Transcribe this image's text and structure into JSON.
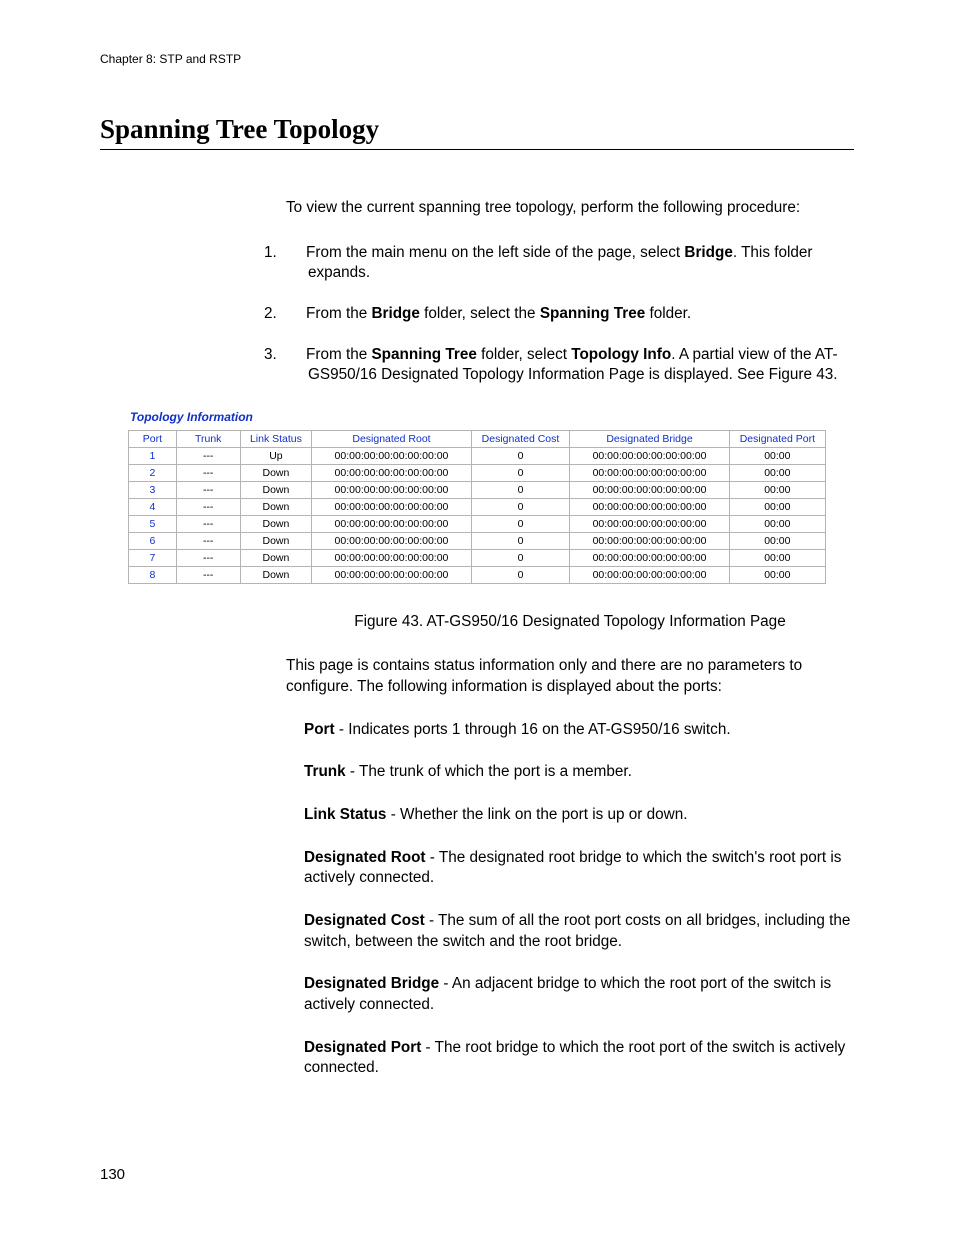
{
  "header": {
    "chapter": "Chapter 8: STP and RSTP"
  },
  "section_title": "Spanning Tree Topology",
  "intro": "To view the current spanning tree topology, perform the following procedure:",
  "steps": {
    "one": {
      "num": "1.",
      "pre": "From the main menu on the left side of the page, select ",
      "bold": "Bridge",
      "post": ". This folder expands."
    },
    "two": {
      "num": "2.",
      "pre": "From the ",
      "b1": "Bridge",
      "mid": " folder, select the ",
      "b2": "Spanning Tree",
      "post": " folder."
    },
    "three": {
      "num": "3.",
      "pre": "From the ",
      "b1": "Spanning Tree",
      "mid": " folder, select ",
      "b2": "Topology Info",
      "post": ". A partial view of the AT-GS950/16 Designated Topology Information Page is displayed. See Figure 43."
    }
  },
  "figure": {
    "title": "Topology Information",
    "headers": {
      "port": "Port",
      "trunk": "Trunk",
      "link": "Link Status",
      "root": "Designated Root",
      "cost": "Designated Cost",
      "bridge": "Designated Bridge",
      "dport": "Designated Port"
    },
    "rows": {
      "r1": {
        "port": "1",
        "trunk": "---",
        "link": "Up",
        "root": "00:00:00:00:00:00:00:00",
        "cost": "0",
        "bridge": "00:00:00:00:00:00:00:00",
        "dport": "00:00"
      },
      "r2": {
        "port": "2",
        "trunk": "---",
        "link": "Down",
        "root": "00:00:00:00:00:00:00:00",
        "cost": "0",
        "bridge": "00:00:00:00:00:00:00:00",
        "dport": "00:00"
      },
      "r3": {
        "port": "3",
        "trunk": "---",
        "link": "Down",
        "root": "00:00:00:00:00:00:00:00",
        "cost": "0",
        "bridge": "00:00:00:00:00:00:00:00",
        "dport": "00:00"
      },
      "r4": {
        "port": "4",
        "trunk": "---",
        "link": "Down",
        "root": "00:00:00:00:00:00:00:00",
        "cost": "0",
        "bridge": "00:00:00:00:00:00:00:00",
        "dport": "00:00"
      },
      "r5": {
        "port": "5",
        "trunk": "---",
        "link": "Down",
        "root": "00:00:00:00:00:00:00:00",
        "cost": "0",
        "bridge": "00:00:00:00:00:00:00:00",
        "dport": "00:00"
      },
      "r6": {
        "port": "6",
        "trunk": "---",
        "link": "Down",
        "root": "00:00:00:00:00:00:00:00",
        "cost": "0",
        "bridge": "00:00:00:00:00:00:00:00",
        "dport": "00:00"
      },
      "r7": {
        "port": "7",
        "trunk": "---",
        "link": "Down",
        "root": "00:00:00:00:00:00:00:00",
        "cost": "0",
        "bridge": "00:00:00:00:00:00:00:00",
        "dport": "00:00"
      },
      "r8": {
        "port": "8",
        "trunk": "---",
        "link": "Down",
        "root": "00:00:00:00:00:00:00:00",
        "cost": "0",
        "bridge": "00:00:00:00:00:00:00:00",
        "dport": "00:00"
      }
    },
    "caption": "Figure 43. AT-GS950/16 Designated Topology Information Page"
  },
  "desc": {
    "intro": "This page is contains status information only and there are no parameters to configure. The following information is displayed about the ports:",
    "port": {
      "label": "Port",
      "text": " - Indicates ports 1 through 16 on the AT-GS950/16 switch."
    },
    "trunk": {
      "label": "Trunk",
      "text": " - The trunk of which the port is a member."
    },
    "link": {
      "label": "Link Status",
      "text": " - Whether the link on the port is up or down."
    },
    "root": {
      "label": "Designated Root",
      "text": " - The designated root bridge to which the switch's root port is actively connected."
    },
    "cost": {
      "label": "Designated Cost",
      "text": " - The sum of all the root port costs on all bridges, including the switch, between the switch and the root bridge."
    },
    "bridge": {
      "label": "Designated Bridge",
      "text": " - An adjacent bridge to which the root port of the switch is actively connected."
    },
    "dport": {
      "label": "Designated Port",
      "text": " - The root bridge to which the root port of the switch is actively connected."
    }
  },
  "page_number": "130"
}
